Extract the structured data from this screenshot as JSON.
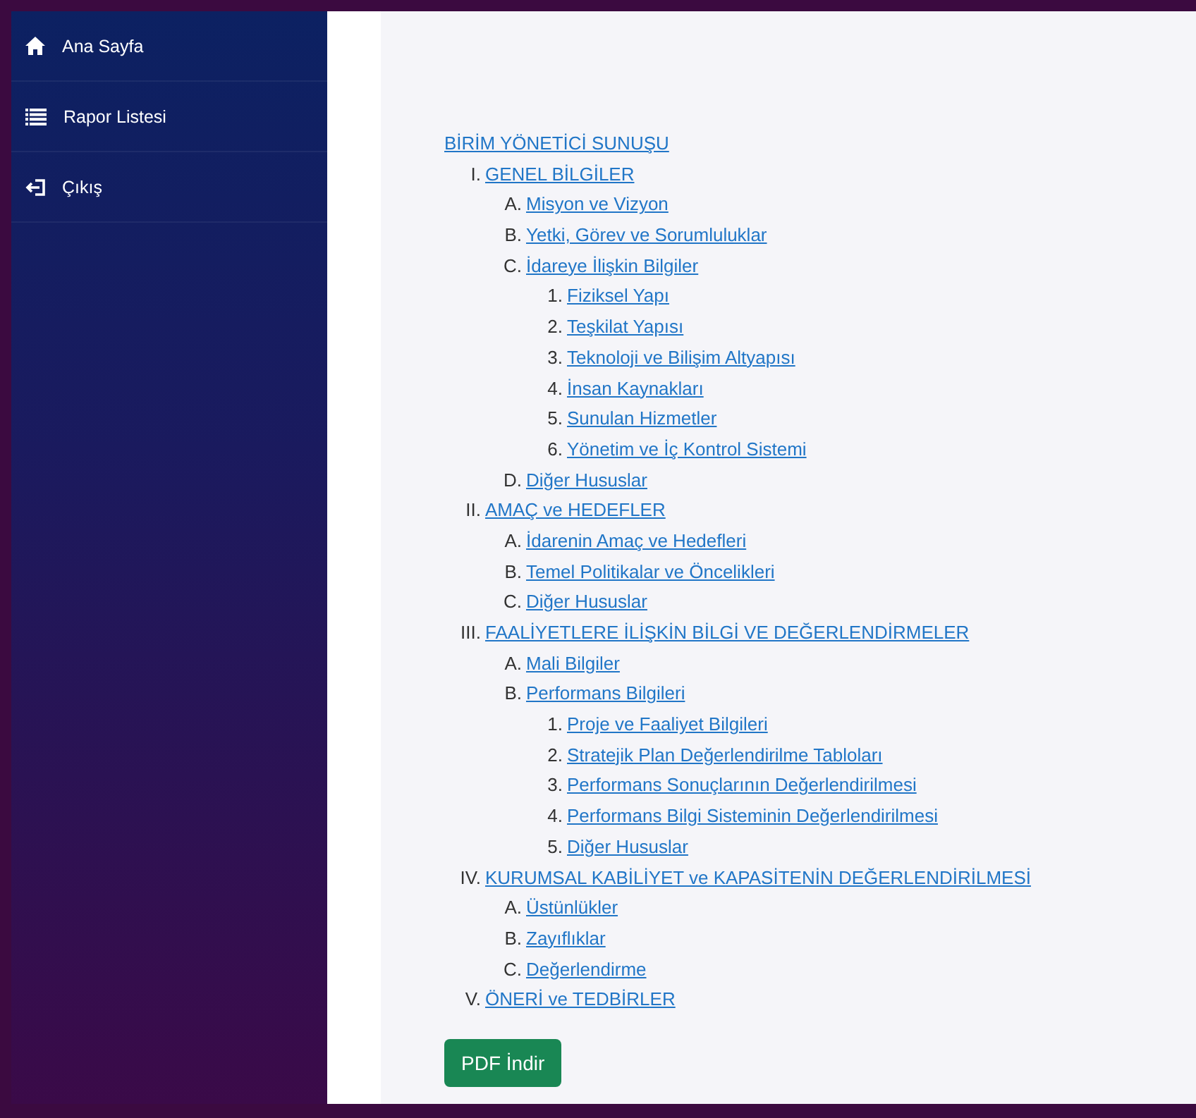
{
  "sidebar": {
    "items": [
      {
        "kind": "home",
        "label": "Ana Sayfa"
      },
      {
        "kind": "list",
        "label": "Rapor Listesi"
      },
      {
        "kind": "exit",
        "label": "Çıkış"
      }
    ]
  },
  "document": {
    "title": "BİRİM YÖNETİCİ SUNUŞU",
    "outline": [
      {
        "marker": "I.",
        "label": "GENEL BİLGİLER",
        "children": [
          {
            "marker": "A.",
            "label": "Misyon ve Vizyon"
          },
          {
            "marker": "B.",
            "label": "Yetki, Görev ve Sorumluluklar"
          },
          {
            "marker": "C.",
            "label": "İdareye İlişkin Bilgiler",
            "children": [
              {
                "marker": "1.",
                "label": "Fiziksel Yapı"
              },
              {
                "marker": "2.",
                "label": "Teşkilat Yapısı"
              },
              {
                "marker": "3.",
                "label": "Teknoloji ve Bilişim Altyapısı"
              },
              {
                "marker": "4.",
                "label": "İnsan Kaynakları"
              },
              {
                "marker": "5.",
                "label": "Sunulan Hizmetler"
              },
              {
                "marker": "6.",
                "label": "Yönetim ve İç Kontrol Sistemi"
              }
            ]
          },
          {
            "marker": "D.",
            "label": "Diğer Hususlar"
          }
        ]
      },
      {
        "marker": "II.",
        "label": "AMAÇ ve HEDEFLER",
        "children": [
          {
            "marker": "A.",
            "label": "İdarenin Amaç ve Hedefleri"
          },
          {
            "marker": "B.",
            "label": "Temel Politikalar ve Öncelikleri"
          },
          {
            "marker": "C.",
            "label": "Diğer Hususlar"
          }
        ]
      },
      {
        "marker": "III.",
        "label": "FAALİYETLERE İLİŞKİN BİLGİ VE DEĞERLENDİRMELER",
        "children": [
          {
            "marker": "A.",
            "label": "Mali Bilgiler"
          },
          {
            "marker": "B.",
            "label": "Performans Bilgileri",
            "children": [
              {
                "marker": "1.",
                "label": "Proje ve Faaliyet Bilgileri"
              },
              {
                "marker": "2.",
                "label": "Stratejik Plan Değerlendirilme Tabloları"
              },
              {
                "marker": "3.",
                "label": "Performans Sonuçlarının Değerlendirilmesi"
              },
              {
                "marker": "4.",
                "label": "Performans Bilgi Sisteminin Değerlendirilmesi"
              },
              {
                "marker": "5.",
                "label": "Diğer Hususlar"
              }
            ]
          }
        ]
      },
      {
        "marker": "IV.",
        "label": "KURUMSAL KABİLİYET ve KAPASİTENİN DEĞERLENDİRİLMESİ",
        "children": [
          {
            "marker": "A.",
            "label": "Üstünlükler"
          },
          {
            "marker": "B.",
            "label": "Zayıflıklar"
          },
          {
            "marker": "C.",
            "label": "Değerlendirme"
          }
        ]
      },
      {
        "marker": "V.",
        "label": "ÖNERİ ve TEDBİRLER"
      }
    ]
  },
  "pdf_button": "PDF İndir"
}
